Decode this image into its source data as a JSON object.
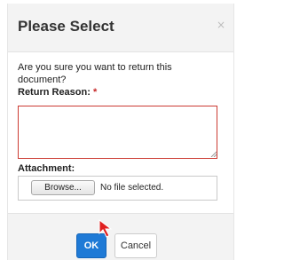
{
  "dialog": {
    "title": "Please Select",
    "close_symbol": "×",
    "question": "Are you sure you want to return this document?",
    "return_reason_label": "Return Reason:",
    "required_marker": "*",
    "return_reason_value": "",
    "attachment_label": "Attachment:",
    "browse_label": "Browse...",
    "no_file_text": "No file selected.",
    "ok_label": "OK",
    "cancel_label": "Cancel"
  },
  "colors": {
    "primary_button": "#1f7ad6",
    "required_border": "#cc3b33",
    "cursor": "#e02020"
  },
  "icons": {
    "cursor": "mouse-pointer-icon",
    "resize": "resize-grip-icon"
  }
}
